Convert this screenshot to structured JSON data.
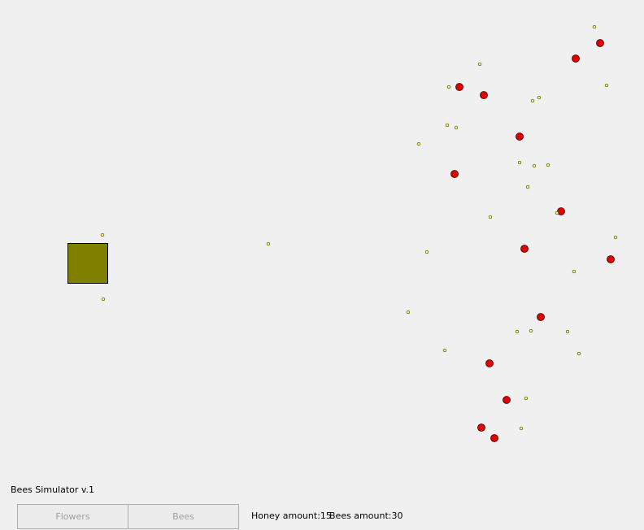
{
  "app": {
    "title": "Bees Simulator v.1"
  },
  "controls": {
    "flowers_label": "Flowers",
    "bees_label": "Bees"
  },
  "status": {
    "honey_text": "Honey amount:15",
    "bees_text": "Bees amount:30"
  },
  "colors": {
    "hive": "#808000",
    "flower": "#e00000",
    "bee": "#ffff80",
    "background": "#f0f0f0"
  }
}
